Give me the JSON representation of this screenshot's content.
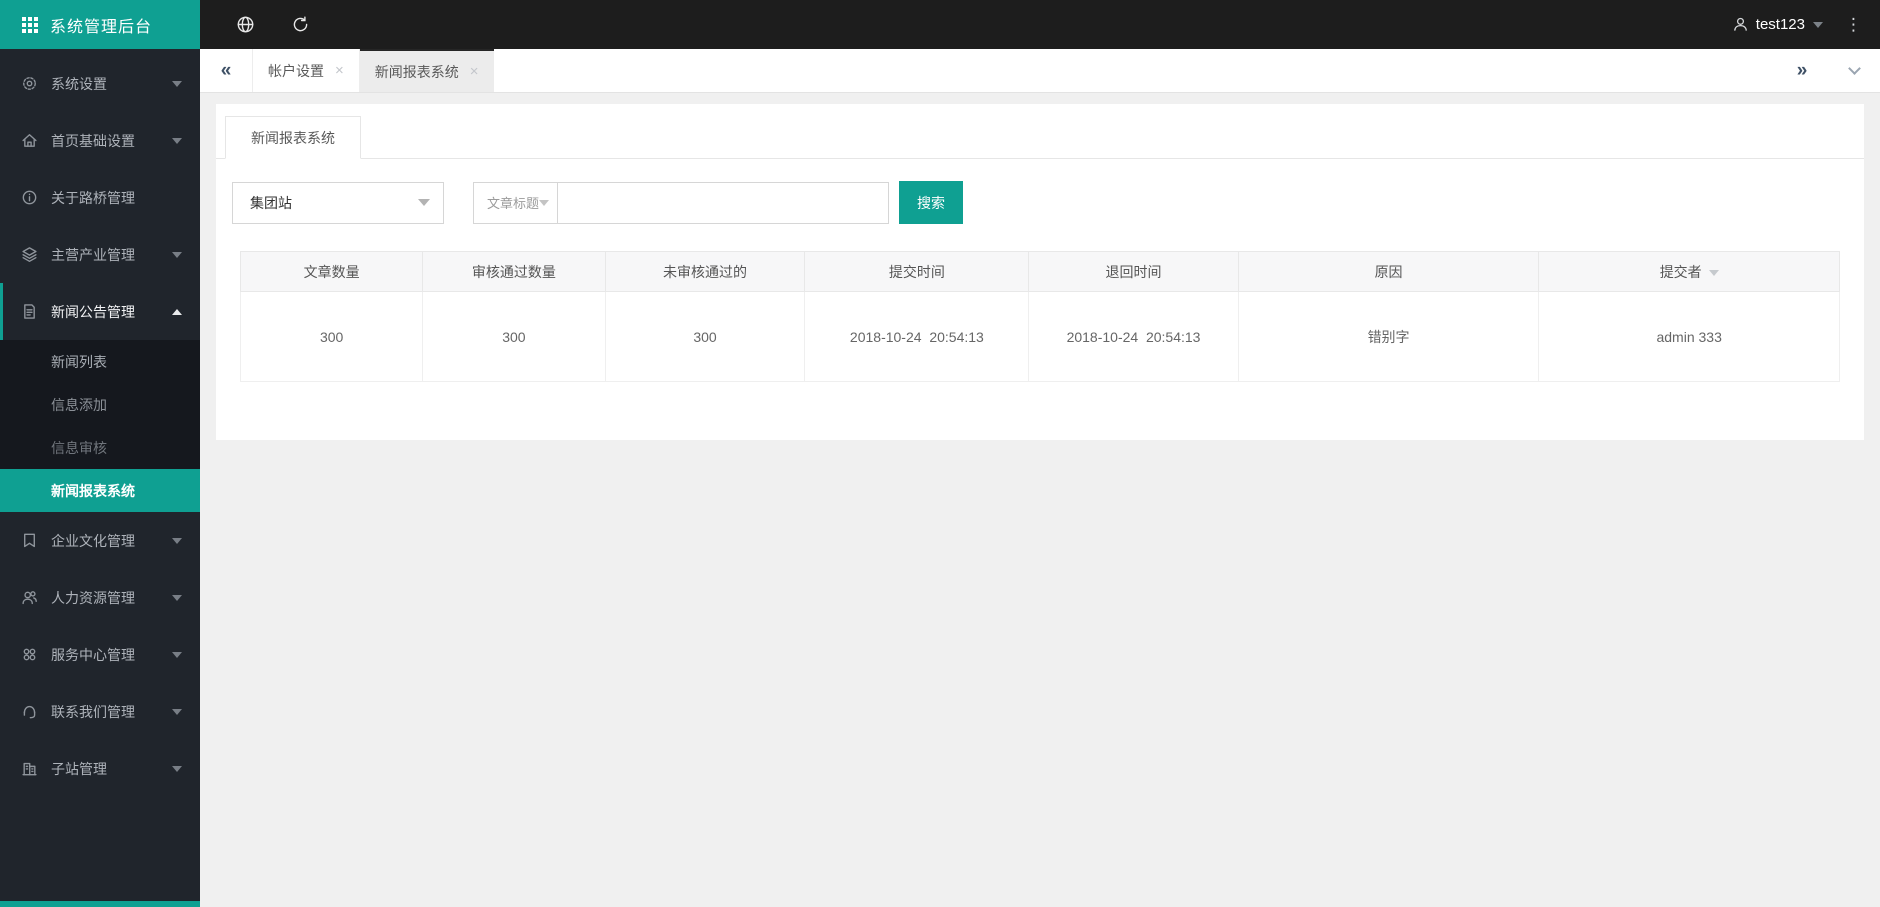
{
  "app": {
    "title": "系统管理后台"
  },
  "topbar": {
    "username": "test123"
  },
  "glyphs": {
    "collapse": "«",
    "expand": "»",
    "close": "×",
    "kebab": "⋮"
  },
  "tab_bar": {
    "tabs": [
      {
        "label": "帐户设置",
        "active": false
      },
      {
        "label": "新闻报表系统",
        "active": true
      }
    ]
  },
  "sidebar": {
    "items": [
      {
        "label": "系统设置",
        "icon": "gear",
        "has_submenu": true
      },
      {
        "label": "首页基础设置",
        "icon": "home",
        "has_submenu": true
      },
      {
        "label": "关于路桥管理",
        "icon": "info",
        "has_submenu": false
      },
      {
        "label": "主营产业管理",
        "icon": "layers",
        "has_submenu": true
      },
      {
        "label": "新闻公告管理",
        "icon": "news-doc",
        "has_submenu": true,
        "expanded": true,
        "children": [
          {
            "label": "新闻列表",
            "active": false
          },
          {
            "label": "信息添加",
            "active": false
          },
          {
            "label": "信息审核",
            "active": false
          },
          {
            "label": "新闻报表系统",
            "active": true
          }
        ]
      },
      {
        "label": "企业文化管理",
        "icon": "culture-flag",
        "has_submenu": true
      },
      {
        "label": "人力资源管理",
        "icon": "users",
        "has_submenu": true
      },
      {
        "label": "服务中心管理",
        "icon": "service-center",
        "has_submenu": true
      },
      {
        "label": "联系我们管理",
        "icon": "headset",
        "has_submenu": true
      },
      {
        "label": "子站管理",
        "icon": "building",
        "has_submenu": true
      }
    ]
  },
  "panel": {
    "tab_label": "新闻报表系统"
  },
  "search": {
    "site_select_value": "集团站",
    "title_select_label": "文章标题",
    "input_value": "",
    "button_label": "搜索"
  },
  "table": {
    "headers": [
      "文章数量",
      "审核通过数量",
      "未审核通过的",
      "提交时间",
      "退回时间",
      "原因",
      "提交者"
    ],
    "rows": [
      [
        "300",
        "300",
        "300",
        "2018-10-24  20:54:13",
        "2018-10-24  20:54:13",
        "错别字",
        "admin 333"
      ]
    ]
  },
  "colors": {
    "accent": "#0fa092",
    "topbar_bg": "#1d1d1d",
    "sidebar_bg": "#20252c",
    "submenu_bg": "#15181e",
    "content_bg": "#f0f0f0"
  }
}
